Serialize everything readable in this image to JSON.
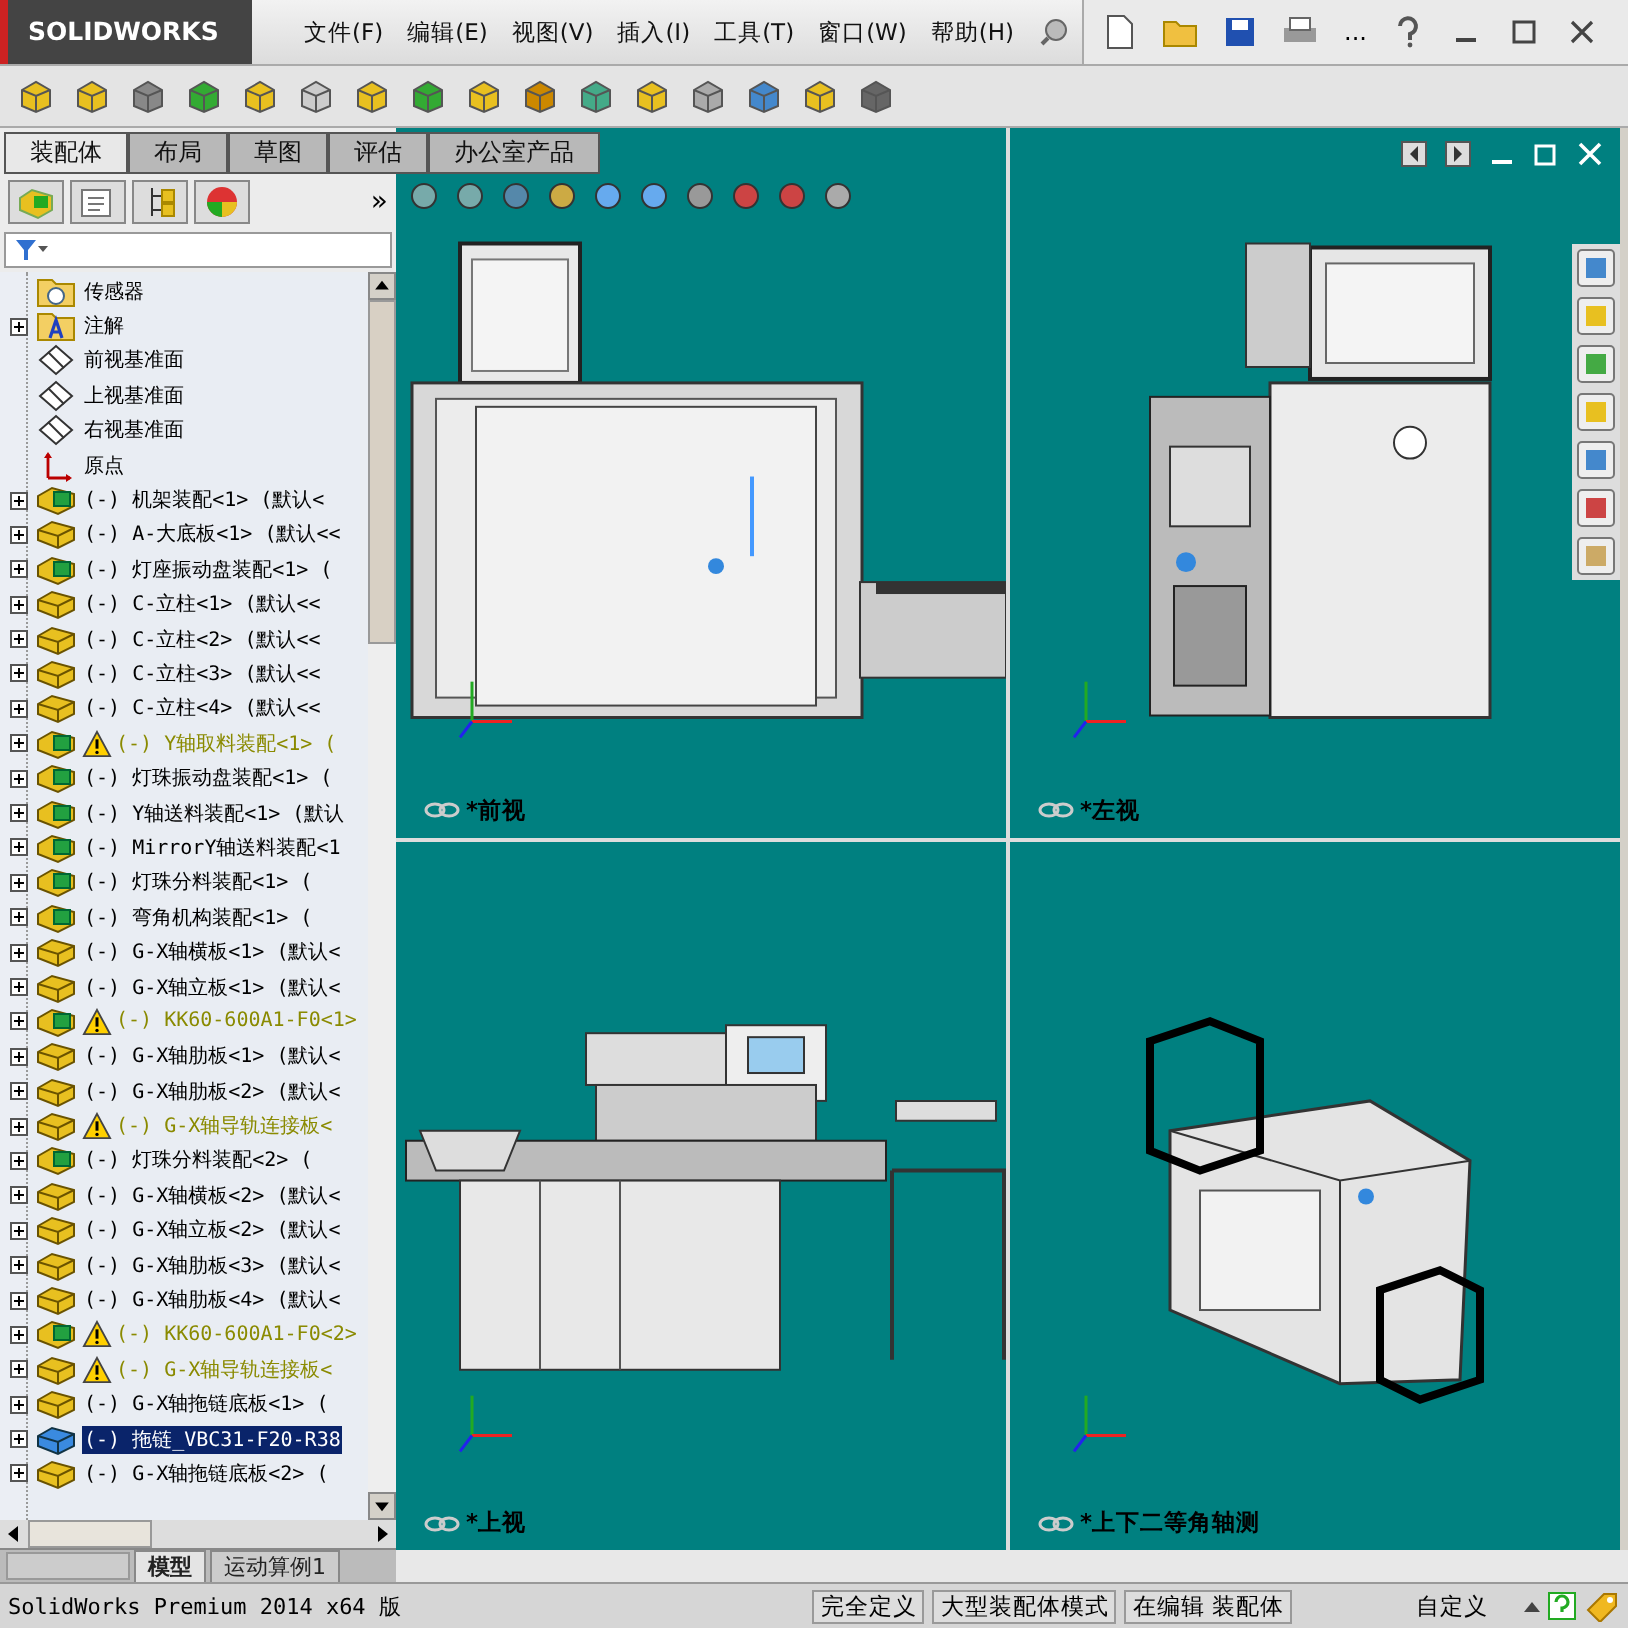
{
  "app": {
    "logo": "SOLIDWORKS"
  },
  "menu": [
    "文件(F)",
    "编辑(E)",
    "视图(V)",
    "插入(I)",
    "工具(T)",
    "窗口(W)",
    "帮助(H)"
  ],
  "toolbar_more": "...",
  "command_tabs": [
    {
      "label": "装配体",
      "selected": true
    },
    {
      "label": "布局",
      "selected": false
    },
    {
      "label": "草图",
      "selected": false
    },
    {
      "label": "评估",
      "selected": false
    },
    {
      "label": "办公室产品",
      "selected": false
    }
  ],
  "panel_more": "»",
  "tree": {
    "items": [
      {
        "kind": "sensor",
        "text": "传感器",
        "warning": false,
        "selected": false
      },
      {
        "kind": "annotation",
        "text": "注解",
        "warning": false,
        "selected": false
      },
      {
        "kind": "plane",
        "text": "前视基准面",
        "warning": false,
        "selected": false
      },
      {
        "kind": "plane",
        "text": "上视基准面",
        "warning": false,
        "selected": false
      },
      {
        "kind": "plane",
        "text": "右视基准面",
        "warning": false,
        "selected": false
      },
      {
        "kind": "origin",
        "text": "原点",
        "warning": false,
        "selected": false
      },
      {
        "kind": "assembly",
        "text": "(-) 机架装配<1> (默认<",
        "warning": false,
        "selected": false
      },
      {
        "kind": "part",
        "text": "(-) A-大底板<1> (默认<<",
        "warning": false,
        "selected": false
      },
      {
        "kind": "assembly",
        "text": "(-) 灯座振动盘装配<1> (",
        "warning": false,
        "selected": false
      },
      {
        "kind": "part",
        "text": "(-) C-立柱<1> (默认<<",
        "warning": false,
        "selected": false
      },
      {
        "kind": "part",
        "text": "(-) C-立柱<2> (默认<<",
        "warning": false,
        "selected": false
      },
      {
        "kind": "part",
        "text": "(-) C-立柱<3> (默认<<",
        "warning": false,
        "selected": false
      },
      {
        "kind": "part",
        "text": "(-) C-立柱<4> (默认<<",
        "warning": false,
        "selected": false
      },
      {
        "kind": "assembly",
        "text": "(-) Y轴取料装配<1> (",
        "warning": true,
        "selected": false
      },
      {
        "kind": "assembly",
        "text": "(-) 灯珠振动盘装配<1> (",
        "warning": false,
        "selected": false
      },
      {
        "kind": "assembly",
        "text": "(-) Y轴送料装配<1> (默认",
        "warning": false,
        "selected": false
      },
      {
        "kind": "assembly",
        "text": "(-) MirrorY轴送料装配<1",
        "warning": false,
        "selected": false
      },
      {
        "kind": "assembly",
        "text": "(-) 灯珠分料装配<1> (",
        "warning": false,
        "selected": false
      },
      {
        "kind": "assembly",
        "text": "(-) 弯角机构装配<1> (",
        "warning": false,
        "selected": false
      },
      {
        "kind": "part",
        "text": "(-) G-X轴横板<1> (默认<",
        "warning": false,
        "selected": false
      },
      {
        "kind": "part",
        "text": "(-) G-X轴立板<1> (默认<",
        "warning": false,
        "selected": false
      },
      {
        "kind": "assembly",
        "text": "(-) KK60-600A1-F0<1>",
        "warning": true,
        "selected": false
      },
      {
        "kind": "part",
        "text": "(-) G-X轴肋板<1> (默认<",
        "warning": false,
        "selected": false
      },
      {
        "kind": "part",
        "text": "(-) G-X轴肋板<2> (默认<",
        "warning": false,
        "selected": false
      },
      {
        "kind": "part",
        "text": "(-) G-X轴导轨连接板<",
        "warning": true,
        "selected": false
      },
      {
        "kind": "assembly",
        "text": "(-) 灯珠分料装配<2> (",
        "warning": false,
        "selected": false
      },
      {
        "kind": "part",
        "text": "(-) G-X轴横板<2> (默认<",
        "warning": false,
        "selected": false
      },
      {
        "kind": "part",
        "text": "(-) G-X轴立板<2> (默认<",
        "warning": false,
        "selected": false
      },
      {
        "kind": "part",
        "text": "(-) G-X轴肋板<3> (默认<",
        "warning": false,
        "selected": false
      },
      {
        "kind": "part",
        "text": "(-) G-X轴肋板<4> (默认<",
        "warning": false,
        "selected": false
      },
      {
        "kind": "assembly",
        "text": "(-) KK60-600A1-F0<2>",
        "warning": true,
        "selected": false
      },
      {
        "kind": "part",
        "text": "(-) G-X轴导轨连接板<",
        "warning": true,
        "selected": false
      },
      {
        "kind": "part",
        "text": "(-) G-X轴拖链底板<1> (",
        "warning": false,
        "selected": false
      },
      {
        "kind": "chain",
        "text": "(-) 拖链_VBC31-F20-R38",
        "warning": false,
        "selected": true
      },
      {
        "kind": "part",
        "text": "(-) G-X轴拖链底板<2> (",
        "warning": false,
        "selected": false
      }
    ]
  },
  "bottom_tabs": [
    {
      "label": "模型",
      "selected": true
    },
    {
      "label": "运动算例1",
      "selected": false
    }
  ],
  "viewports": [
    {
      "kind": "front",
      "label": "*前视"
    },
    {
      "kind": "left",
      "label": "*左视"
    },
    {
      "kind": "top",
      "label": "*上视"
    },
    {
      "kind": "iso",
      "label": "*上下二等角轴测"
    }
  ],
  "status_bar": {
    "product": "SolidWorks Premium 2014 x64 版",
    "fields": [
      "完全定义",
      "大型装配体模式",
      "在编辑 装配体"
    ],
    "custom": "自定义"
  }
}
